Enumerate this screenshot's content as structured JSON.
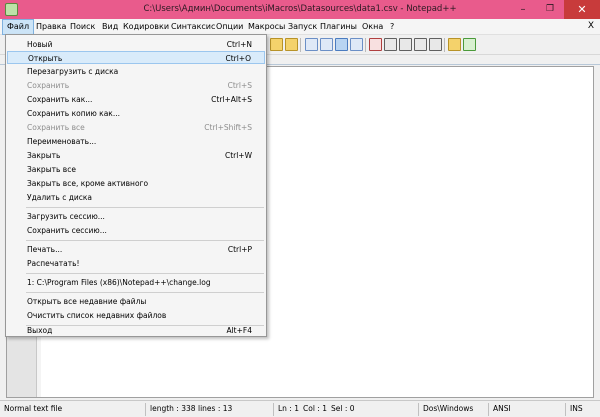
{
  "window": {
    "title": "C:\\Users\\Админ\\Documents\\iMacros\\Datasources\\data1.csv - Notepad++",
    "min_label": "–",
    "max_label": "❐",
    "close_label": "✕"
  },
  "menu": {
    "items": [
      "Файл",
      "Правка",
      "Поиск",
      "Вид",
      "Кодировки",
      "Синтаксис",
      "Опции",
      "Макросы",
      "Запуск",
      "Плагины",
      "Окна",
      "?"
    ],
    "close_doc": "X"
  },
  "file_menu": {
    "items": [
      {
        "label": "Новый",
        "shortcut": "Ctrl+N"
      },
      {
        "label": "Открыть",
        "shortcut": "Ctrl+O"
      },
      {
        "label": "Перезагрузить с диска",
        "shortcut": ""
      },
      {
        "label": "Сохранить",
        "shortcut": "Ctrl+S"
      },
      {
        "label": "Сохранить как...",
        "shortcut": "Ctrl+Alt+S"
      },
      {
        "label": "Сохранить копию как...",
        "shortcut": ""
      },
      {
        "label": "Сохранить все",
        "shortcut": "Ctrl+Shift+S"
      },
      {
        "label": "Переименовать...",
        "shortcut": ""
      },
      {
        "label": "Закрыть",
        "shortcut": "Ctrl+W"
      },
      {
        "label": "Закрыть все",
        "shortcut": ""
      },
      {
        "label": "Закрыть все, кроме активного",
        "shortcut": ""
      },
      {
        "label": "Удалить с диска",
        "shortcut": ""
      },
      {
        "label": "Загрузить сессию...",
        "shortcut": ""
      },
      {
        "label": "Сохранить сессию...",
        "shortcut": ""
      },
      {
        "label": "Печать...",
        "shortcut": "Ctrl+P"
      },
      {
        "label": "Распечатать!",
        "shortcut": ""
      },
      {
        "label": "1: C:\\Program Files (x86)\\Notepad++\\change.log",
        "shortcut": ""
      },
      {
        "label": "Открыть все недавние файлы",
        "shortcut": ""
      },
      {
        "label": "Очистить список недавних файлов",
        "shortcut": ""
      },
      {
        "label": "Выход",
        "shortcut": "Alt+F4"
      }
    ]
  },
  "status": {
    "type": "Normal text file",
    "length": "length : 338",
    "lines": "lines : 13",
    "ln": "Ln : 1",
    "col": "Col : 1",
    "sel": "Sel : 0",
    "eol": "Dos\\Windows",
    "encoding": "ANSI",
    "mode": "INS"
  },
  "colors": {
    "titlebar": "#e95b8c",
    "menu_active": "#cce4f7",
    "dropdown_hover": "#d9ebfa"
  }
}
